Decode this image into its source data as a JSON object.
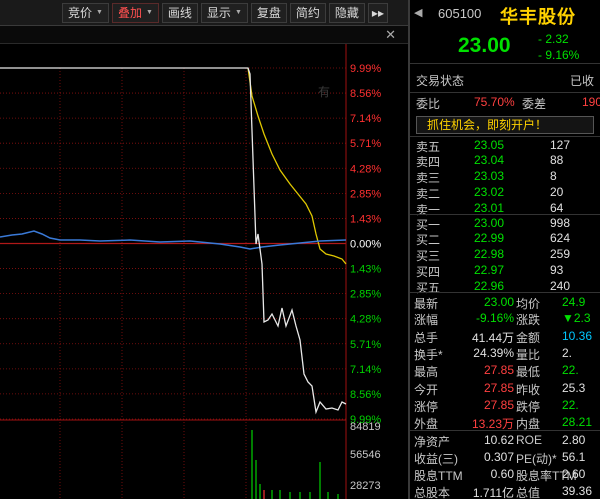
{
  "toolbar": {
    "items": [
      {
        "label": "竞价",
        "caret": true,
        "active": false
      },
      {
        "label": "叠加",
        "caret": true,
        "active": true
      },
      {
        "label": "画线",
        "caret": false,
        "active": false
      },
      {
        "label": "显示",
        "caret": true,
        "active": false
      },
      {
        "label": "复盘",
        "caret": false,
        "active": false
      },
      {
        "label": "简约",
        "caret": false,
        "active": false
      },
      {
        "label": "隐藏",
        "caret": false,
        "active": false
      }
    ],
    "more": "▸▸"
  },
  "chart": {
    "close": "✕",
    "watermark": "有",
    "right_axis": {
      "up": [
        "9.99%",
        "8.56%",
        "7.14%",
        "5.71%",
        "4.28%",
        "2.85%",
        "1.43%"
      ],
      "zero": "0.00%",
      "down": [
        "1.43%",
        "2.85%",
        "4.28%",
        "5.71%",
        "7.14%",
        "8.56%",
        "9.99%"
      ]
    },
    "volume_axis": [
      "84819",
      "56546",
      "28273"
    ],
    "colors": {
      "up": "#ff3030",
      "down": "#00d000",
      "zero": "#ffffff",
      "price": "#e8e8e8",
      "avg": "#e0c800",
      "index": "#3a7ad8",
      "grid": "#8b1010"
    }
  },
  "stock": {
    "back": "◀",
    "code": "605100",
    "name": "华丰股份",
    "price": "23.00",
    "change": "- 2.32",
    "change_pct": "- 9.16%"
  },
  "status": {
    "label": "交易状态",
    "value": "已收"
  },
  "weibi": {
    "label1": "委比",
    "value1": "75.70%",
    "label2": "委差",
    "value2": "190"
  },
  "promo": "抓住机会，即刻开户！",
  "sells": [
    {
      "label": "卖五",
      "price": "23.05",
      "vol": "127"
    },
    {
      "label": "卖四",
      "price": "23.04",
      "vol": "88"
    },
    {
      "label": "卖三",
      "price": "23.03",
      "vol": "8"
    },
    {
      "label": "卖二",
      "price": "23.02",
      "vol": "20"
    },
    {
      "label": "卖一",
      "price": "23.01",
      "vol": "64"
    }
  ],
  "buys": [
    {
      "label": "买一",
      "price": "23.00",
      "vol": "998"
    },
    {
      "label": "买二",
      "price": "22.99",
      "vol": "624"
    },
    {
      "label": "买三",
      "price": "22.98",
      "vol": "259"
    },
    {
      "label": "买四",
      "price": "22.97",
      "vol": "93"
    },
    {
      "label": "买五",
      "price": "22.96",
      "vol": "240"
    }
  ],
  "stats": [
    {
      "l1": "最新",
      "v1": "23.00",
      "c1": "green",
      "l2": "均价",
      "v2": "24.9",
      "c2": "green"
    },
    {
      "l1": "涨幅",
      "v1": "-9.16%",
      "c1": "green",
      "l2": "涨跌",
      "v2": "▼2.3",
      "c2": "green"
    },
    {
      "l1": "总手",
      "v1": "41.44万",
      "c1": "white",
      "l2": "金额",
      "v2": "10.36",
      "c2": "cyan"
    },
    {
      "l1": "换手*",
      "v1": "24.39%",
      "c1": "white",
      "l2": "量比",
      "v2": "2.",
      "c2": "white"
    },
    {
      "l1": "最高",
      "v1": "27.85",
      "c1": "red",
      "l2": "最低",
      "v2": "22.",
      "c2": "green"
    },
    {
      "l1": "今开",
      "v1": "27.85",
      "c1": "red",
      "l2": "昨收",
      "v2": "25.3",
      "c2": "white"
    },
    {
      "l1": "涨停",
      "v1": "27.85",
      "c1": "red",
      "l2": "跌停",
      "v2": "22.",
      "c2": "green"
    },
    {
      "l1": "外盘",
      "v1": "13.23万",
      "c1": "red",
      "l2": "内盘",
      "v2": "28.21",
      "c2": "green"
    },
    {
      "l1": "净资产",
      "v1": "10.62",
      "c1": "white",
      "l2": "ROE",
      "v2": "2.80",
      "c2": "white"
    },
    {
      "l1": "收益(三)",
      "v1": "0.307",
      "c1": "white",
      "l2": "PE(动)*",
      "v2": "56.1",
      "c2": "white"
    },
    {
      "l1": "股息TTM",
      "v1": "0.60",
      "c1": "white",
      "l2": "股息率TTM",
      "v2": "2.60",
      "c2": "white"
    },
    {
      "l1": "总股本",
      "v1": "1.711亿",
      "c1": "white",
      "l2": "总值",
      "v2": "39.36",
      "c2": "white"
    }
  ]
}
